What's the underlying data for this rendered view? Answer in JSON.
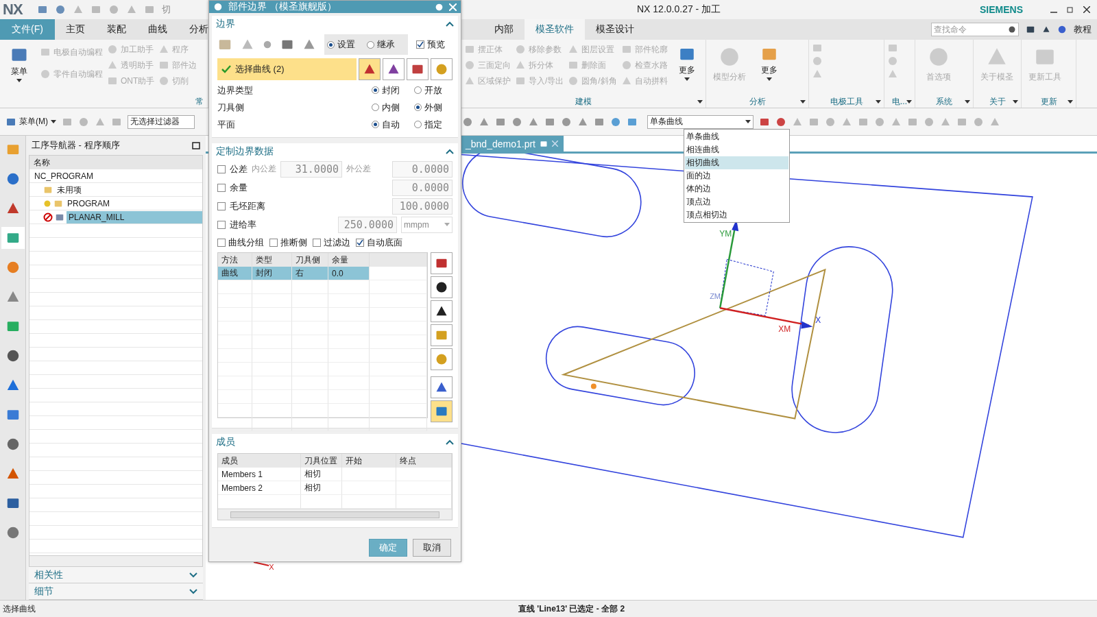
{
  "title_bar": {
    "logo": "NX",
    "cut_item": "切",
    "title": "NX 12.0.0.27 - 加工",
    "brand": "SIEMENS"
  },
  "file_menu": "文件(F)",
  "tabs_left": [
    {
      "label": "主页",
      "selected": false
    },
    {
      "label": "装配",
      "selected": false
    },
    {
      "label": "曲线",
      "selected": false
    },
    {
      "label": "分析",
      "selected": false
    }
  ],
  "tabs_right": [
    {
      "label": "内部",
      "selected": false
    },
    {
      "label": "模圣软件",
      "selected": true
    },
    {
      "label": "模圣设计",
      "selected": false
    }
  ],
  "search": {
    "placeholder": "查找命令"
  },
  "help_label": "教程",
  "ribbon_left": {
    "menu_button": "菜单",
    "columns": [
      [
        "电极自动编程",
        "零件自动编程"
      ],
      [
        "加工助手",
        "透明助手",
        "ONT助手"
      ],
      [
        "程序",
        "部件边",
        "切削"
      ]
    ],
    "group_label": "常"
  },
  "ribbon_groups": [
    {
      "label": "建模",
      "columns": [
        [
          "摆正体",
          "三面定向",
          "区域保护"
        ],
        [
          "移除参数",
          "拆分体",
          "导入/导出"
        ],
        [
          "图层设置",
          "删除面",
          "圆角/斜角"
        ],
        [
          "部件轮廓",
          "检查水路",
          "自动拼料"
        ]
      ],
      "big": "更多"
    },
    {
      "label": "分析",
      "big_left": "模型分析",
      "big": "更多"
    },
    {
      "label": "电极工具"
    },
    {
      "label": "电..."
    },
    {
      "label": "系统",
      "big_left": "首选项"
    },
    {
      "label": "关于",
      "big_left": "关于模圣"
    },
    {
      "label": "更新",
      "big_left": "更新工具"
    }
  ],
  "toolbar": {
    "menu": "菜单(M)",
    "filter": "无选择过滤器",
    "curve_rule": "单条曲线"
  },
  "curve_rule_menu": [
    {
      "label": "单条曲线",
      "selected": false
    },
    {
      "label": "相连曲线",
      "selected": false
    },
    {
      "label": "相切曲线",
      "selected": true
    },
    {
      "label": "面的边",
      "selected": false
    },
    {
      "label": "体的边",
      "selected": false
    },
    {
      "label": "顶点边",
      "selected": false
    },
    {
      "label": "顶点相切边",
      "selected": false
    }
  ],
  "side_tabs": [
    {
      "selected": false
    },
    {
      "selected": false
    },
    {
      "selected": false
    },
    {
      "selected": true
    },
    {
      "selected": false
    },
    {
      "selected": false
    },
    {
      "selected": false
    },
    {
      "selected": false
    },
    {
      "selected": false
    },
    {
      "selected": false
    },
    {
      "selected": false
    },
    {
      "selected": false
    },
    {
      "selected": false
    },
    {
      "selected": false
    }
  ],
  "navigator": {
    "title": "工序导航器 - 程序顺序",
    "column": "名称",
    "tree": [
      {
        "label": "NC_PROGRAM",
        "selected": false,
        "children": [
          {
            "label": "未用项",
            "kind": "folder",
            "selected": false
          },
          {
            "label": "PROGRAM",
            "kind": "program",
            "selected": false
          },
          {
            "label": "PLANAR_MILL",
            "kind": "operation",
            "selected": true
          }
        ]
      }
    ],
    "sections": [
      {
        "label": "相关性",
        "expanded": false
      },
      {
        "label": "细节",
        "expanded": false
      }
    ]
  },
  "viewport": {
    "tab": "_bnd_demo1.prt",
    "axis_labels": {
      "y": "YM",
      "x": "XM",
      "z": "ZM",
      "x_tip": "X",
      "x_small": "X"
    }
  },
  "dialog": {
    "title": "部件边界 （模圣旗舰版）",
    "boundary": {
      "label": "边界",
      "expanded": true,
      "mode": [
        {
          "label": "设置",
          "selected": true
        },
        {
          "label": "继承",
          "selected": false
        }
      ],
      "preview": {
        "label": "预览",
        "checked": true
      },
      "select": {
        "label": "选择曲线 (2)",
        "done": true
      },
      "options": [
        {
          "label": "边界类型",
          "choices": [
            {
              "label": "封闭",
              "selected": true
            },
            {
              "label": "开放",
              "selected": false
            }
          ]
        },
        {
          "label": "刀具侧",
          "choices": [
            {
              "label": "内侧",
              "selected": false
            },
            {
              "label": "外侧",
              "selected": true
            }
          ]
        },
        {
          "label": "平面",
          "choices": [
            {
              "label": "自动",
              "selected": true
            },
            {
              "label": "指定",
              "selected": false
            }
          ]
        }
      ]
    },
    "custom": {
      "label": "定制边界数据",
      "expanded": true,
      "tolerance": {
        "label": "公差",
        "checked": false,
        "inner_label": "内公差",
        "inner": "31.0000",
        "outer_label": "外公差",
        "outer": "0.0000"
      },
      "rows": [
        {
          "label": "余量",
          "checked": false,
          "value": "0.0000"
        },
        {
          "label": "毛坯距离",
          "checked": false,
          "value": "100.0000"
        }
      ],
      "feed": {
        "label": "进给率",
        "checked": false,
        "value": "250.0000",
        "unit": "mmpm"
      },
      "flags": [
        {
          "label": "曲线分组",
          "checked": false
        },
        {
          "label": "推断侧",
          "checked": false
        },
        {
          "label": "过滤边",
          "checked": false
        },
        {
          "label": "自动底面",
          "checked": true
        }
      ],
      "table": {
        "columns": [
          "方法",
          "类型",
          "刀具侧",
          "余量"
        ],
        "rows": [
          {
            "cells": [
              "曲线",
              "封闭",
              "右",
              "0.0"
            ],
            "selected": true
          }
        ]
      }
    },
    "members": {
      "label": "成员",
      "expanded": true,
      "columns": [
        "成员",
        "刀具位置",
        "开始",
        "终点"
      ],
      "rows": [
        [
          "Members 1",
          "相切",
          "",
          ""
        ],
        [
          "Members 2",
          "相切",
          "",
          ""
        ]
      ]
    },
    "buttons": [
      {
        "label": "确定",
        "kind": "primary"
      },
      {
        "label": "取消",
        "kind": "normal"
      }
    ]
  },
  "status_bar": {
    "prompt": "选择曲线",
    "message": "直线 'Line13' 已选定 - 全部 2"
  }
}
